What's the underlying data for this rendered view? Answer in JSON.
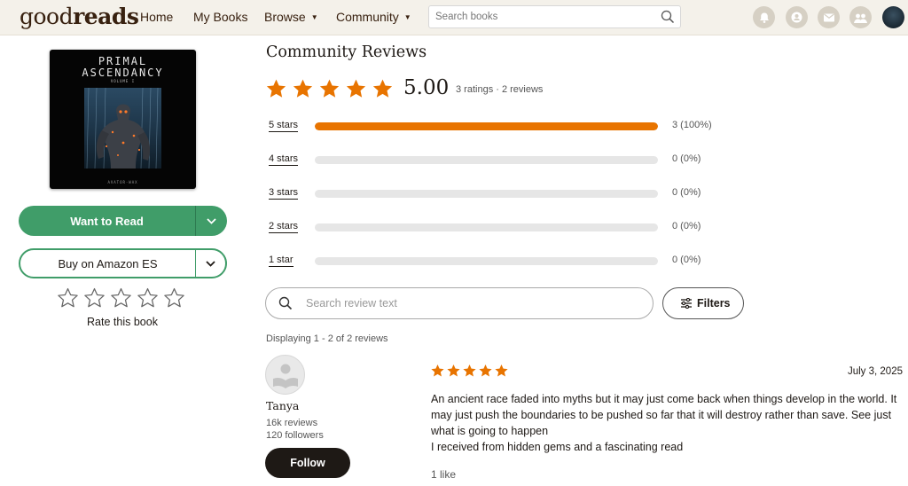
{
  "header": {
    "logo_light": "good",
    "logo_bold": "reads",
    "nav": [
      {
        "label": "Home"
      },
      {
        "label": "My Books"
      },
      {
        "label": "Browse"
      },
      {
        "label": "Community"
      }
    ],
    "search_placeholder": "Search books",
    "icons": [
      "notifications-icon",
      "friends-chat-icon",
      "messages-icon",
      "friends-icon",
      "profile-avatar"
    ]
  },
  "book": {
    "cover_title_line1": "PRIMAL",
    "cover_title_line2": "ASCENDANCY",
    "cover_subtitle": "VOLUME I",
    "cover_author": "AVATOR·WAX",
    "want_to_read_label": "Want to Read",
    "buy_label": "Buy on Amazon ES",
    "rate_label": "Rate this book"
  },
  "reviews": {
    "title": "Community Reviews",
    "average": "5.00",
    "counts_text": "3 ratings · 2 reviews",
    "histogram": [
      {
        "label": "5 stars",
        "fraction": 1.0,
        "value": "3 (100%)"
      },
      {
        "label": "4 stars",
        "fraction": 0.0,
        "value": "0 (0%)"
      },
      {
        "label": "3 stars",
        "fraction": 0.0,
        "value": "0 (0%)"
      },
      {
        "label": "2 stars",
        "fraction": 0.0,
        "value": "0 (0%)"
      },
      {
        "label": "1 star",
        "fraction": 0.0,
        "value": "0 (0%)"
      }
    ],
    "search_placeholder": "Search review text",
    "filters_label": "Filters",
    "displaying": "Displaying 1 - 2 of 2 reviews"
  },
  "review": {
    "reviewer_name": "Tanya",
    "reviewer_reviews": "16k reviews",
    "reviewer_followers": "120 followers",
    "follow_label": "Follow",
    "rating": 5,
    "date": "July 3, 2025",
    "paragraph1": "An ancient race faded into myths but it may just come back when things develop in the world. It may just push the boundaries to be pushed so far that it will destroy rather than save. See just what is going to happen",
    "paragraph2": "I received from hidden gems and a fascinating read",
    "likes": "1 like"
  },
  "colors": {
    "star": "#e87400",
    "green": "#409d69",
    "header_bg": "#f4f1ea",
    "dark": "#1e1915"
  }
}
